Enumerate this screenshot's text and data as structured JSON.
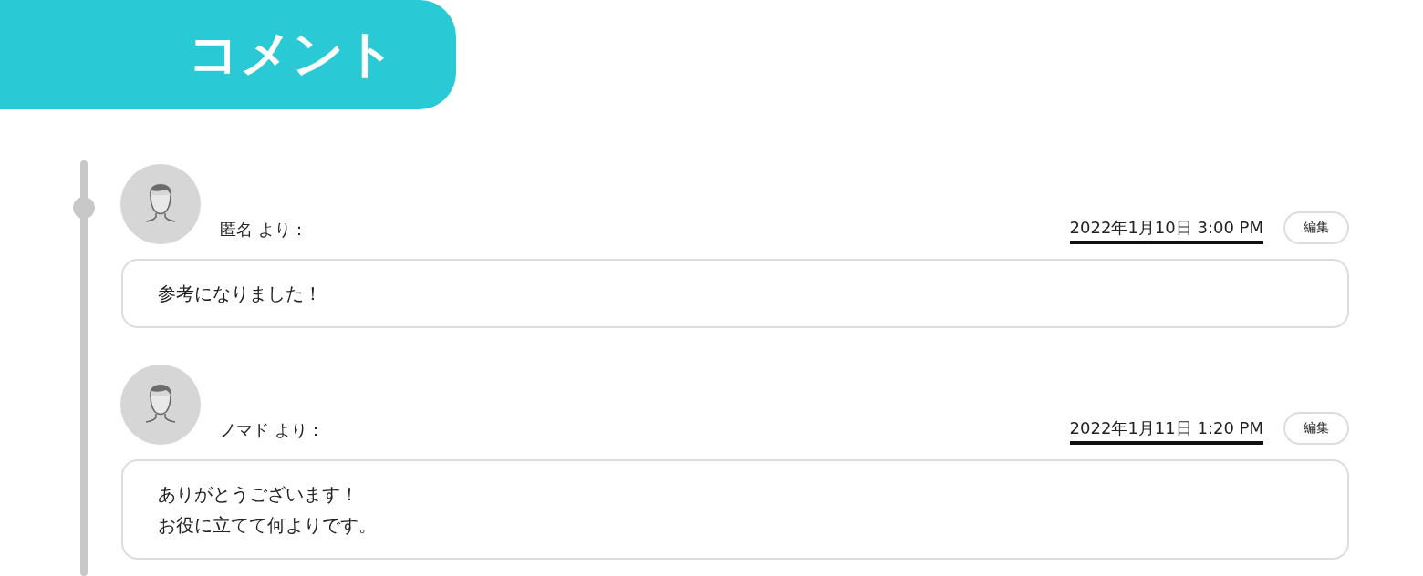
{
  "header": {
    "title": "コメント"
  },
  "comments": [
    {
      "author": "匿名 より：",
      "date": "2022年1月10日 3:00 PM",
      "edit_button": "編集",
      "body": [
        "参考になりました！"
      ]
    },
    {
      "author": "ノマド より：",
      "date": "2022年1月11日 1:20 PM",
      "edit_button": "編集",
      "body": [
        "ありがとうございます！",
        "お役に立てて何よりです。"
      ]
    }
  ]
}
